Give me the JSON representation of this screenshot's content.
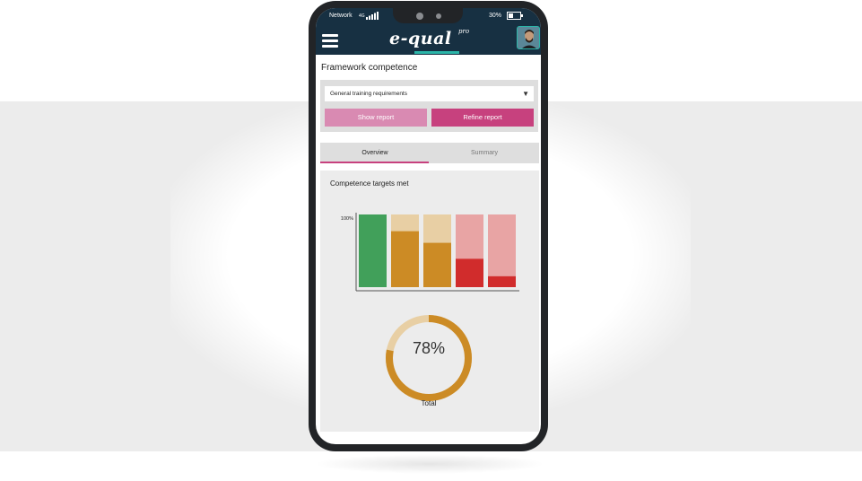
{
  "status_bar": {
    "network_label": "Network",
    "network_type": "4G",
    "battery_label": "30%"
  },
  "app_bar": {
    "logo_text": "e-qual",
    "logo_superscript": "pro",
    "menu_icon": "hamburger-menu-icon",
    "avatar_icon": "user-avatar"
  },
  "page": {
    "title": "Framework competence"
  },
  "filters": {
    "selected_option": "General training requirements",
    "caret_icon": "triangle-down-icon",
    "show_report_label": "Show report",
    "refine_report_label": "Refine report"
  },
  "tabs": [
    {
      "label": "Overview",
      "active": true
    },
    {
      "label": "Summary",
      "active": false
    }
  ],
  "card": {
    "title": "Competence targets met"
  },
  "chart_data": [
    {
      "type": "bar",
      "title": "Competence targets met",
      "y_tick_label": "100%",
      "ylim": [
        0,
        100
      ],
      "categories": [
        "",
        "",
        "",
        "",
        ""
      ],
      "series": [
        {
          "values": [
            100,
            77,
            61,
            39,
            15
          ]
        }
      ],
      "colors": {
        "fill": [
          "#41a05a",
          "#cc8b25",
          "#cc8b25",
          "#d12c2c",
          "#d12c2c"
        ],
        "remainder": [
          "#41a05a",
          "#e8cfa4",
          "#e8cfa4",
          "#e8a4a4",
          "#e8a4a4"
        ]
      },
      "grid": false
    },
    {
      "type": "pie",
      "value": 78,
      "value_label": "78%",
      "label": "Total",
      "colors": {
        "fill": "#cc8b25",
        "remainder": "#e8cfa4"
      }
    }
  ],
  "colors": {
    "header": "#173042",
    "accent_teal": "#2bb5a8",
    "primary_pink": "#c7417e",
    "light_pink": "#d98ab2"
  }
}
